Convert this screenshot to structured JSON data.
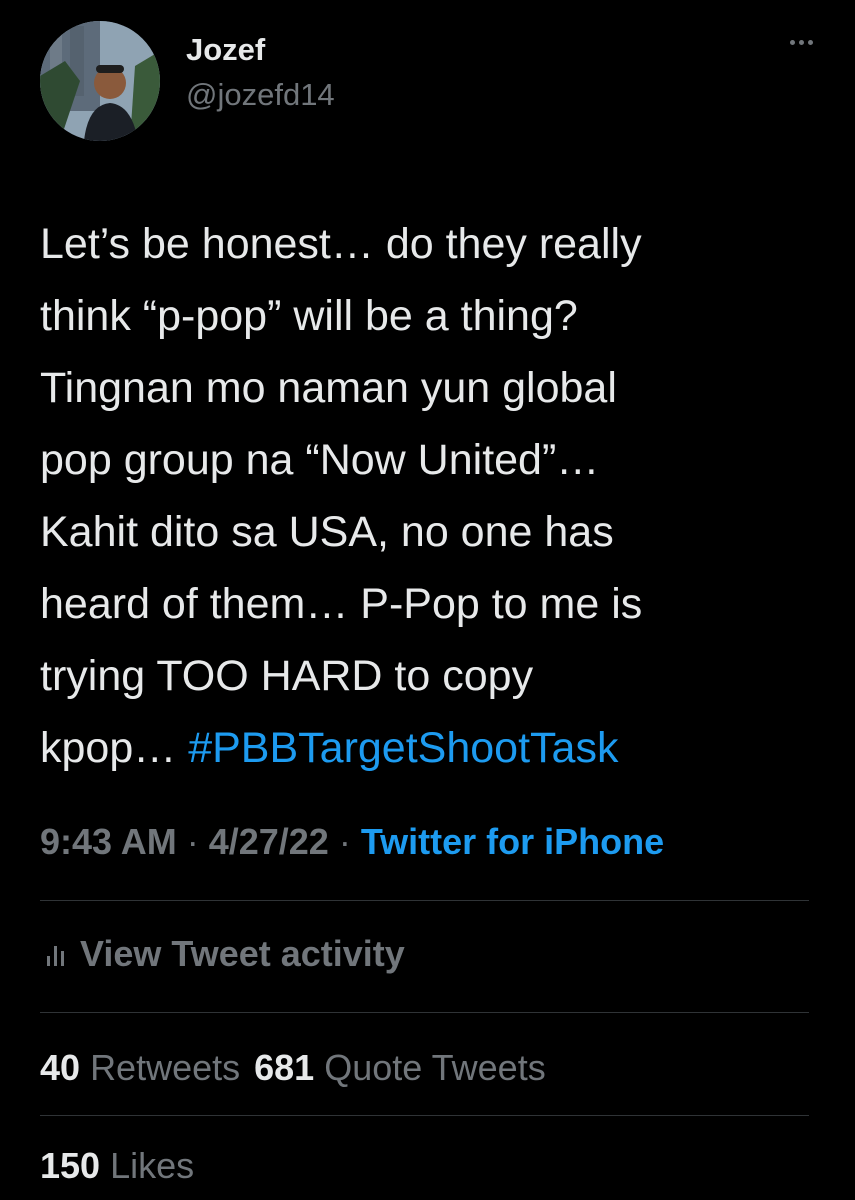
{
  "author": {
    "display_name": "Jozef",
    "handle": "@jozefd14"
  },
  "tweet": {
    "text_lines": [
      "Let’s be honest… do they really",
      "think “p-pop” will be a thing?",
      "Tingnan mo naman yun global",
      "pop group na “Now United”…",
      "Kahit dito sa USA, no one has",
      "heard of them… P-Pop to me is",
      "trying TOO HARD to copy"
    ],
    "last_line_prefix": "kpop… ",
    "hashtag": "#PBBTargetShootTask"
  },
  "meta": {
    "time": "9:43 AM",
    "sep1": " · ",
    "date": "4/27/22",
    "sep2": " · ",
    "source": "Twitter for iPhone"
  },
  "activity": {
    "label": "View Tweet activity",
    "icon": "bar-chart-icon"
  },
  "stats": {
    "retweets_count": "40",
    "retweets_label": "Retweets",
    "quotes_count": "681",
    "quotes_label": "Quote Tweets",
    "likes_count": "150",
    "likes_label": "Likes"
  },
  "colors": {
    "background": "#000000",
    "text": "#e7e9ea",
    "secondary": "#71767b",
    "accent": "#1d9bf0",
    "divider": "#2f3336"
  }
}
